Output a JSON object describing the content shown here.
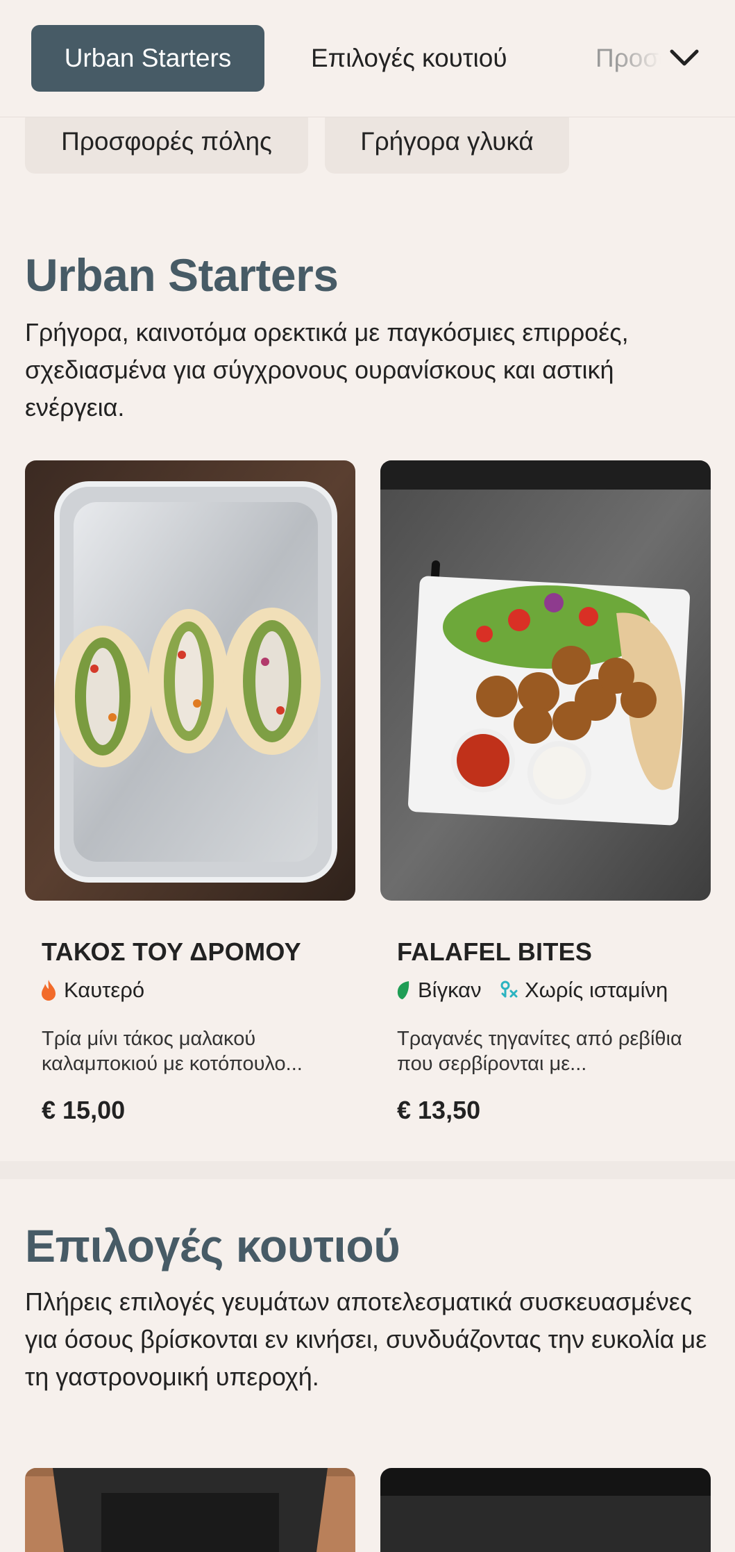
{
  "nav": {
    "tabs": [
      "Urban Starters",
      "Επιλογές κουτιού",
      "Προσφορές πόλης"
    ],
    "chips": [
      "Προσφορές πόλης",
      "Γρήγορα γλυκά"
    ]
  },
  "sections": [
    {
      "title": "Urban Starters",
      "description": "Γρήγορα, καινοτόμα ορεκτικά με παγκόσμιες επιρροές, σχεδιασμένα για σύγχρονους ουρανίσκους και αστική ενέργεια.",
      "items": [
        {
          "name": "ΤΑΚΟΣ ΤΟΥ ΔΡΟΜΟΥ",
          "tags": [
            {
              "label": "Καυτερό",
              "icon": "flame-icon",
              "color": "#f26b2a"
            }
          ],
          "description": "Τρία μίνι τάκος μαλακού καλαμποκιού με κοτόπουλο...",
          "price": "€ 15,00"
        },
        {
          "name": "FALAFEL BITES",
          "tags": [
            {
              "label": "Βίγκαν",
              "icon": "leaf-icon",
              "color": "#1f9d55"
            },
            {
              "label": "Χωρίς ισταμίνη",
              "icon": "histamine-free-icon",
              "color": "#2bb3c0"
            }
          ],
          "description": "Τραγανές τηγανίτες από ρεβίθια που σερβίρονται με...",
          "price": "€ 13,50"
        }
      ]
    },
    {
      "title": "Επιλογές κουτιού",
      "description": "Πλήρεις επιλογές γευμάτων αποτελεσματικά συσκευασμένες για όσους βρίσκονται εν κινήσει, συνδυάζοντας την ευκολία με τη γαστρονομική υπεροχή."
    }
  ],
  "colors": {
    "accent": "#475b66",
    "background": "#f6f0ec"
  }
}
